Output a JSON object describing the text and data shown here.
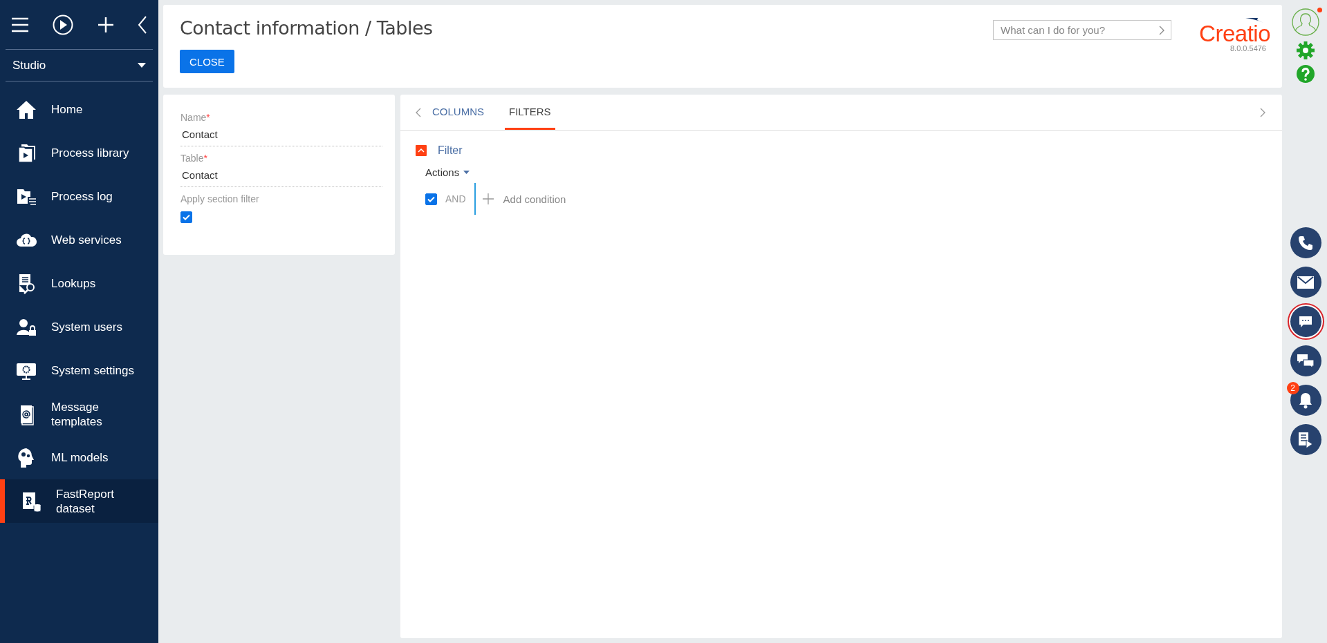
{
  "sidebar": {
    "workplace": "Studio",
    "items": [
      {
        "label": "Home",
        "selected": false
      },
      {
        "label": "Process library",
        "selected": false
      },
      {
        "label": "Process log",
        "selected": false
      },
      {
        "label": "Web services",
        "selected": false
      },
      {
        "label": "Lookups",
        "selected": false
      },
      {
        "label": "System users",
        "selected": false
      },
      {
        "label": "System settings",
        "selected": false
      },
      {
        "label": "Message templates",
        "selected": false
      },
      {
        "label": "ML models",
        "selected": false
      },
      {
        "label": "FastReport dataset",
        "selected": true
      }
    ]
  },
  "header": {
    "title": "Contact information / Tables",
    "close_button": "CLOSE",
    "search": {
      "placeholder": "What can I do for you?"
    },
    "logo": "Creatio",
    "version": "8.0.0.5476"
  },
  "form": {
    "fields": [
      {
        "label": "Name",
        "required_mark": "*",
        "value": "Contact"
      },
      {
        "label": "Table",
        "required_mark": "*",
        "value": "Contact"
      }
    ],
    "apply_section_filter": {
      "label": "Apply section filter",
      "checked": true
    }
  },
  "tabs": [
    {
      "label": "COLUMNS",
      "selected": false
    },
    {
      "label": "FILTERS",
      "selected": true
    }
  ],
  "filter": {
    "title": "Filter",
    "expanded": true,
    "actions": "Actions",
    "group": {
      "checked": true,
      "operator": "AND",
      "add_condition": "Add condition"
    }
  },
  "right_bar": {
    "buttons": [
      {
        "selected": false
      },
      {
        "selected": false
      },
      {
        "selected": true
      },
      {
        "selected": false
      },
      {
        "selected": false,
        "badge": "2"
      },
      {
        "selected": false
      }
    ]
  }
}
